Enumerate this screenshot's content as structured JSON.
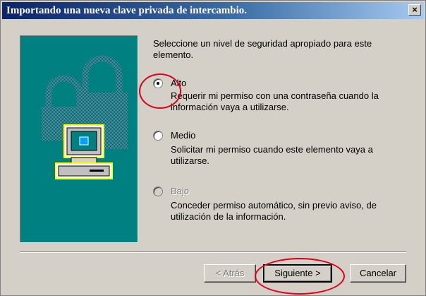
{
  "window": {
    "title": "Importando una nueva clave privada de intercambio.",
    "close_label": "×"
  },
  "prompt": "Seleccione un nivel de seguridad apropiado para este elemento.",
  "options": [
    {
      "label": "Alto",
      "description": "Requerir mi permiso con una contraseña cuando la información vaya a utilizarse.",
      "checked": true,
      "enabled": true
    },
    {
      "label": "Medio",
      "description": "Solicitar mi permiso cuando este elemento vaya a utilizarse.",
      "checked": false,
      "enabled": true
    },
    {
      "label": "Bajo",
      "description": "Conceder permiso automático, sin previo aviso, de utilización de la información.",
      "checked": false,
      "enabled": false
    }
  ],
  "buttons": {
    "back": "< Atrás",
    "next": "Siguiente >",
    "cancel": "Cancelar"
  },
  "colors": {
    "title_bar": "#0a246a",
    "art_background": "#008080",
    "annotation": "#e0001b"
  }
}
